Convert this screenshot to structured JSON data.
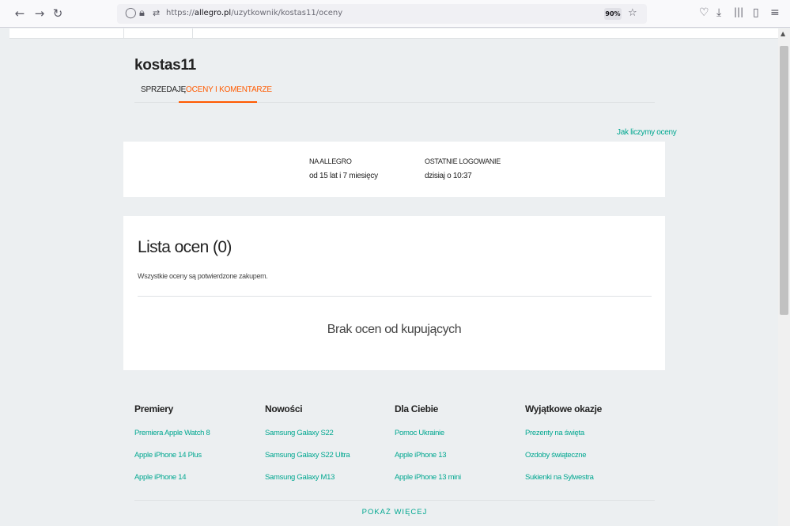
{
  "browser": {
    "url_prefix": "https://",
    "url_domain": "allegro.pl",
    "url_path": "/uzytkownik/kostas11/oceny",
    "zoom": "90%"
  },
  "profile": {
    "username": "kostas11",
    "tabs": [
      {
        "label": "SPRZEDAJĘ"
      },
      {
        "label": "OCENY I KOMENTARZE"
      }
    ],
    "how_we_count": "Jak liczymy oceny"
  },
  "info": {
    "on_allegro_label": "NA ALLEGRO",
    "on_allegro_value": "od 15 lat i 7 miesięcy",
    "last_login_label": "OSTATNIE LOGOWANIE",
    "last_login_value": "dzisiaj o 10:37"
  },
  "ratings": {
    "title": "Lista ocen (0)",
    "subtitle": "Wszystkie oceny są potwierdzone zakupem.",
    "empty_message": "Brak ocen od kupujących"
  },
  "footer": {
    "columns": [
      {
        "heading": "Premiery",
        "links": [
          "Premiera Apple Watch 8",
          "Apple iPhone 14 Plus",
          "Apple iPhone 14"
        ]
      },
      {
        "heading": "Nowości",
        "links": [
          "Samsung Galaxy S22",
          "Samsung Galaxy S22 Ultra",
          "Samsung Galaxy M13"
        ]
      },
      {
        "heading": "Dla Ciebie",
        "links": [
          "Pomoc Ukrainie",
          "Apple iPhone 13",
          "Apple iPhone 13 mini"
        ]
      },
      {
        "heading": "Wyjątkowe okazje",
        "links": [
          "Prezenty na święta",
          "Ozdoby świąteczne",
          "Sukienki na Sylwestra"
        ]
      }
    ],
    "show_more": "POKAŻ WIĘCEJ"
  },
  "colors": {
    "accent": "#ff5a00",
    "link": "#00a790",
    "background": "#eceff1"
  }
}
